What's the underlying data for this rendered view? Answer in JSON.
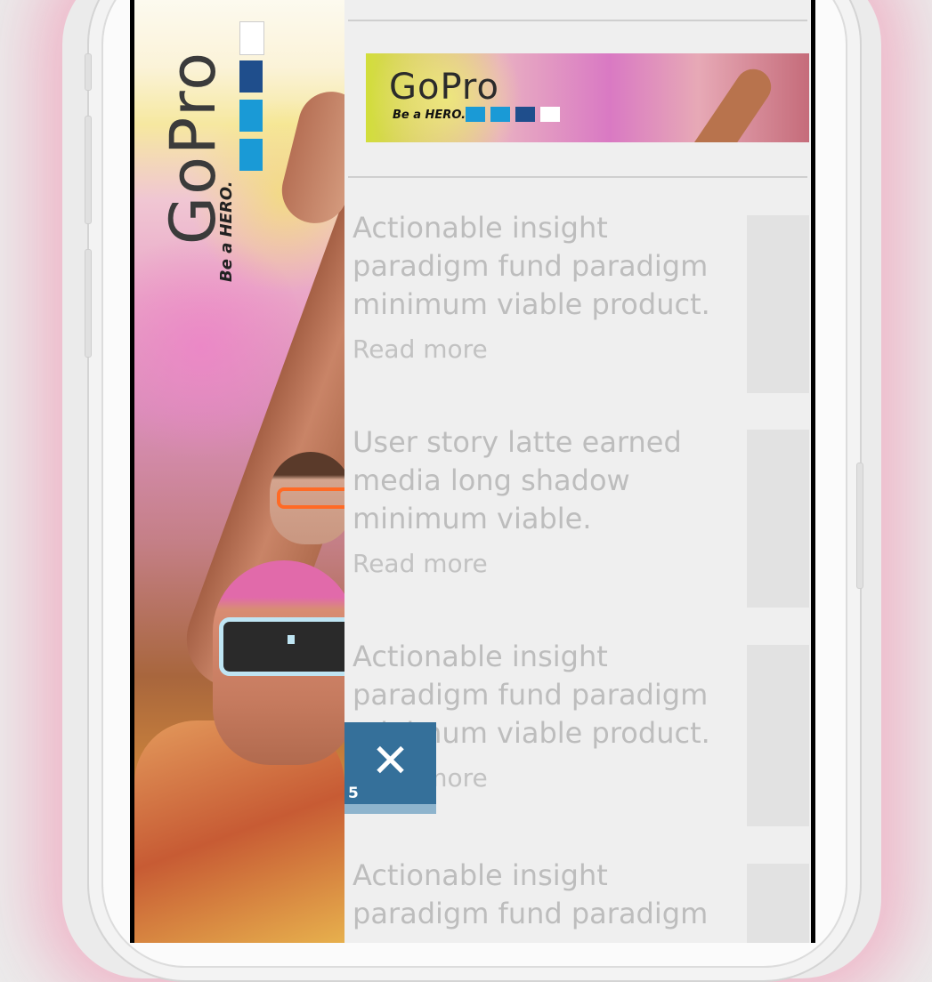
{
  "side_ad": {
    "brand": "GoPro",
    "tagline": "Be a HERO.",
    "colors": [
      "#ffffff",
      "#1f4e8c",
      "#1a9ad6",
      "#1a9ad6"
    ]
  },
  "top_banner": {
    "brand": "GoPro",
    "tagline": "Be a HERO.",
    "colors": [
      "#1a9ad6",
      "#1a9ad6",
      "#1f4e8c",
      "#ffffff"
    ]
  },
  "articles": [
    {
      "title": "Actionable insight paradigm fund paradigm minimum viable product.",
      "link": "Read more"
    },
    {
      "title": "User story latte earned media long shadow minimum viable.",
      "link": "Read more"
    },
    {
      "title": "Actionable insight paradigm fund paradigm minimum viable product.",
      "link": "Read more"
    },
    {
      "title": "Actionable insight paradigm fund paradigm",
      "link": ""
    }
  ],
  "close_overlay": {
    "icon": "close-icon",
    "glyph": "✕",
    "countdown": "5"
  }
}
